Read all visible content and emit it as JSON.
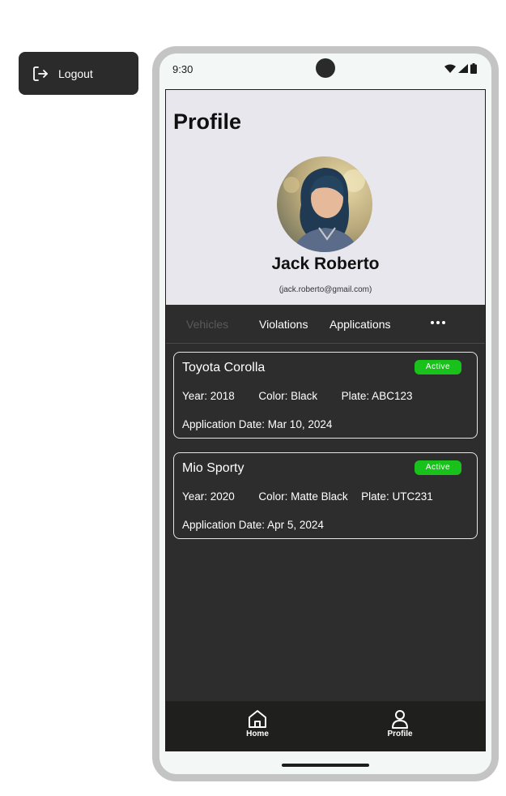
{
  "sidebar": {
    "logout_label": "Logout"
  },
  "status_bar": {
    "time": "9:30"
  },
  "profile": {
    "title": "Profile",
    "name": "Jack Roberto",
    "email": "(jack.roberto@gmail.com)"
  },
  "tabs": [
    {
      "label": "Vehicles",
      "active": false
    },
    {
      "label": "Violations",
      "active": true
    },
    {
      "label": "Applications",
      "active": true
    }
  ],
  "vehicles": [
    {
      "name": "Toyota Corolla",
      "status": "Active",
      "year": "Year: 2018",
      "color": "Color: Black",
      "plate": "Plate: ABC123",
      "application_date": "Application Date: Mar 10, 2024"
    },
    {
      "name": "Mio Sporty",
      "status": "Active",
      "year": "Year: 2020",
      "color": "Color: Matte Black",
      "plate": "Plate: UTC231",
      "application_date": "Application Date: Apr 5, 2024"
    }
  ],
  "bottom_nav": [
    {
      "label": "Home",
      "icon": "home-icon"
    },
    {
      "label": "Profile",
      "icon": "person-icon"
    }
  ],
  "colors": {
    "active_badge": "#18c21a",
    "screen_bg": "#2d2d2d",
    "header_bg": "#e8e7ee"
  }
}
